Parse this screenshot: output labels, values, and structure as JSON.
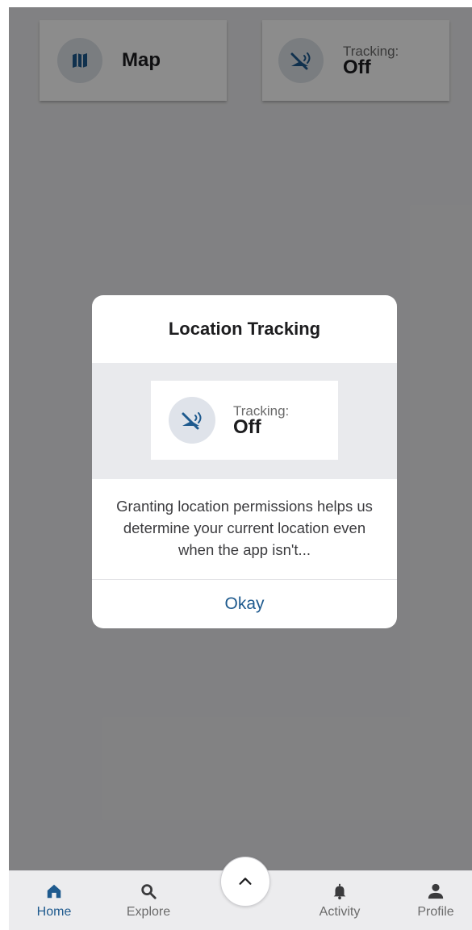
{
  "cards": {
    "map_label": "Map",
    "tracking_label": "Tracking:",
    "tracking_value": "Off"
  },
  "dialog": {
    "title": "Location Tracking",
    "preview_label": "Tracking:",
    "preview_value": "Off",
    "body": "Granting location permissions helps us determine your current location even when the app isn't...",
    "button": "Okay"
  },
  "tabbar": {
    "home": "Home",
    "explore": "Explore",
    "activity": "Activity",
    "profile": "Profile"
  },
  "colors": {
    "accent": "#1e5a8e",
    "overlay": "#000000",
    "card_bg": "#ffffff",
    "icon_bg": "#dfe3ea"
  },
  "icons": {
    "map": "map-icon",
    "tracking": "location-off-icon",
    "home": "home-icon",
    "explore": "search-icon",
    "activity": "bell-icon",
    "profile": "person-icon",
    "center": "chevron-up-icon"
  }
}
